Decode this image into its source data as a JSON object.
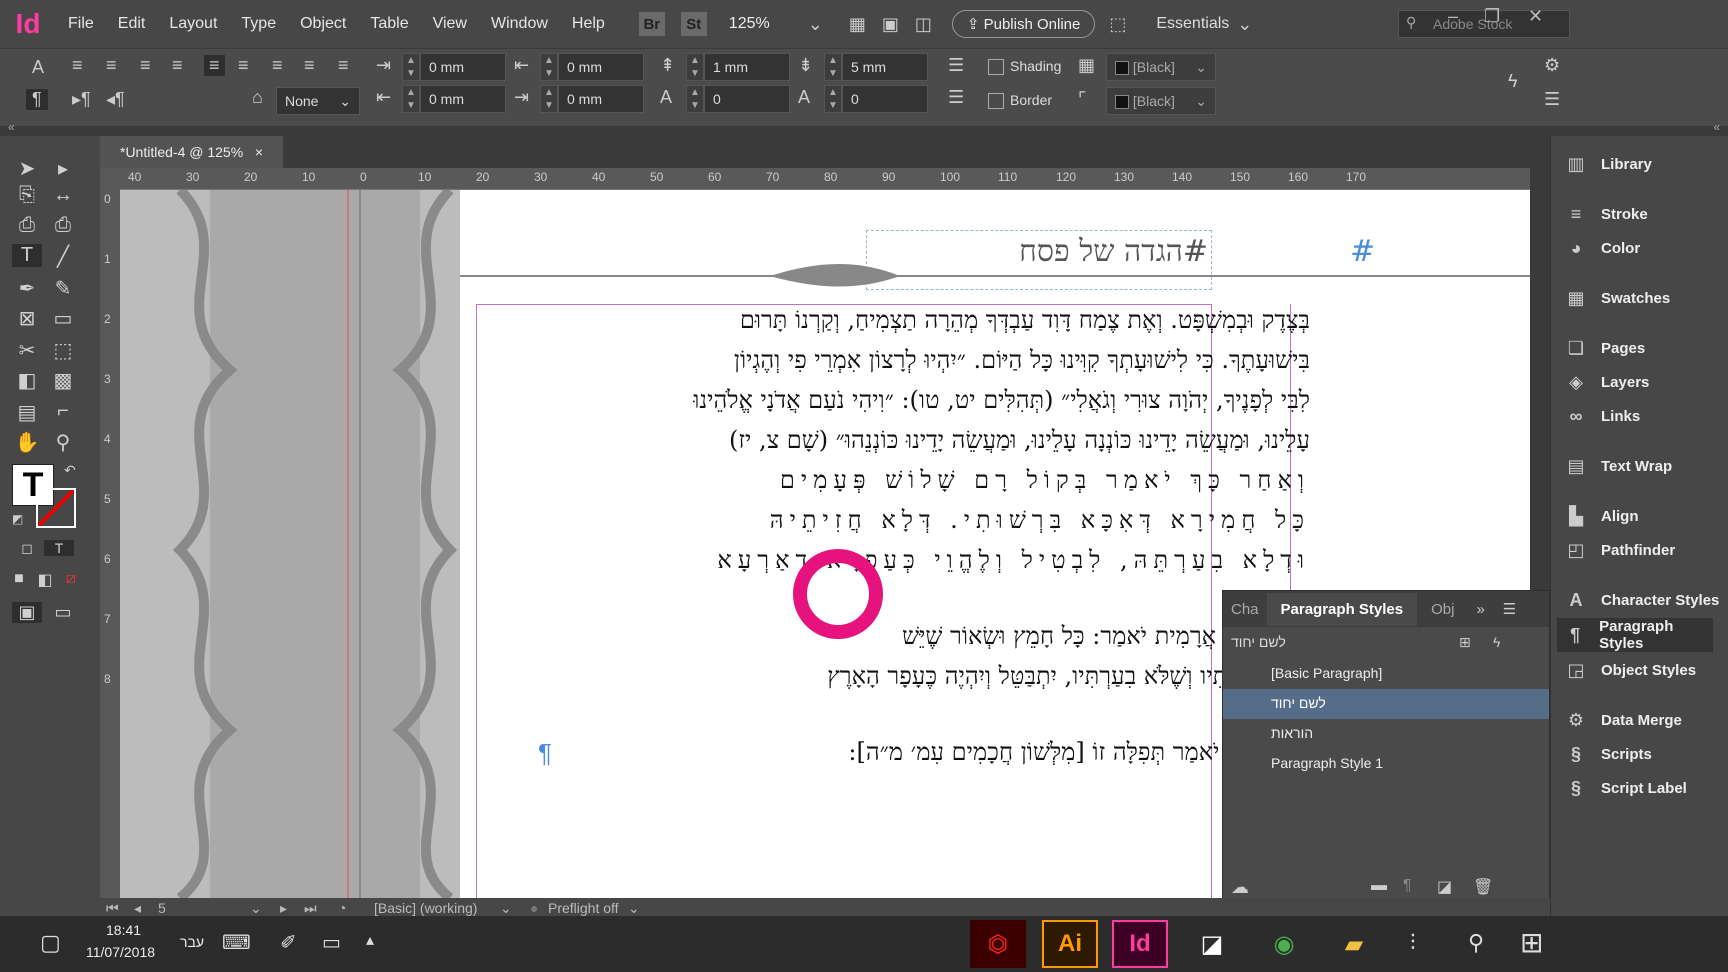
{
  "app": {
    "logo": "Id"
  },
  "menu": [
    "File",
    "Edit",
    "Layout",
    "Type",
    "Object",
    "Table",
    "View",
    "Window",
    "Help"
  ],
  "menubar": {
    "bridge": "Br",
    "stock": "St",
    "zoom": "125%",
    "publish": "Publish Online",
    "workspace": "Essentials",
    "search_placeholder": "Adobe Stock"
  },
  "control": {
    "indent_left": "0 mm",
    "indent_right": "0 mm",
    "space_before": "1 mm",
    "space_after": "5 mm",
    "first_line": "0 mm",
    "last_line": "0 mm",
    "drop_lines": "0",
    "drop_chars": "0",
    "baseline": "None",
    "shading": "Shading",
    "border": "Border",
    "swatch1": "[Black]",
    "swatch2": "[Black]"
  },
  "document": {
    "tab": "*Untitled-4 @ 125%",
    "close": "×"
  },
  "ruler": [
    "40",
    "30",
    "20",
    "10",
    "0",
    "10",
    "20",
    "30",
    "40",
    "50",
    "60",
    "70",
    "80",
    "90",
    "100",
    "110",
    "120",
    "130",
    "140",
    "150",
    "160",
    "170"
  ],
  "vruler": [
    "0",
    "1",
    "2",
    "3",
    "4",
    "5",
    "6",
    "7",
    "8"
  ],
  "page": {
    "heading": "#הגדה של פסח",
    "heading2": "#",
    "lines": [
      "בְּצֶדֶק וּבְמִשְׁפָּט. וְאֶת צֶמַח דָּוִד עַבְדְּךָ מְהֵרָה תַצְמִיחַ, וְקַרְנוֹ תָּרוּם",
      "בִּישׁוּעָתֶךָ. כִּי לִישׁוּעָתְךָ קִוִּינוּ כָּל הַיּוֹם. ״יִהְיוּ לְרָצוֹן אִמְרֵי פִי וְהֶגְיוֹן",
      "לִבִּי לְפָנֶיךָ, יְהֹוָה צוּרִי וְגֹאֲלִי״ (תְּהִלִּים יט, טו): ״וִיהִי נֹעַם אֲדֹנָי אֱלֹהֵינוּ",
      "עָלֵינוּ, וּמַעֲשֵׂה יָדֵינוּ כּוֹנְנָה עָלֵינוּ, וּמַעֲשֵׂה יָדֵינוּ כּוֹנְנֵהוּ״ (שָׁם צ, יז)",
      "וְאַחַר כָּךְ יֹאמַר בְּקוֹל רָם שָׁלוֹשׁ פְּעָמִים",
      "כָּל חֲמִירָא דְּאִכָּא בִּרְשׁוּתִי. דְּלָא חֲזִיתֵיהּ",
      "וּדְלָא בִעַרְתֵּהּ, לִבְטִיל וְלֶהֱוֵי כְּעַפְרָא דְאַרְעָא",
      "מֵבִין לָשׁוֹן אֲרָמִית יֹאמַר: כָּל חָמֵץ וּשְׂאוֹר שֶׁיֵּשׁ",
      "שֶׁלֹּא רְאִיתִיו וְשֶׁלֹּא בִעַרְתִּיו, יִתְבַּטֵּל וְיִהְיֶה כֶּעָפָר הָאָרֶץ",
      "רֵי הַבִּטּוּל יֹאמַר תְּפִלָּה זוֹ [מִלְּשׁוֹן חֲכָמִים עִמ׳ מ״ה]:"
    ],
    "pilcrow": "¶"
  },
  "panel": {
    "tab_char": "Cha",
    "tab_para": "Paragraph Styles",
    "tab_obj": "Obj",
    "current": "לשם יחוד",
    "styles": [
      "[Basic Paragraph]",
      "לשם יחוד",
      "הוראות",
      "Paragraph Style 1"
    ]
  },
  "right_panels": [
    "Library",
    "Stroke",
    "Color",
    "Swatches",
    "Pages",
    "Layers",
    "Links",
    "Text Wrap",
    "Align",
    "Pathfinder",
    "Character Styles",
    "Paragraph Styles",
    "Object Styles",
    "Data Merge",
    "Scripts",
    "Script Label"
  ],
  "status": {
    "page": "5",
    "style": "[Basic] (working)",
    "preflight": "Preflight off"
  },
  "taskbar": {
    "time": "18:41",
    "date": "11/07/2018",
    "lang": "עבר",
    "apps": [
      "Acrobat",
      "Ai",
      "Id",
      "Notes",
      "Chrome",
      "Explorer"
    ]
  },
  "colors": {
    "accent": "#ff3aa0",
    "selected": "#566d8a",
    "annotation": "#e6137e"
  }
}
